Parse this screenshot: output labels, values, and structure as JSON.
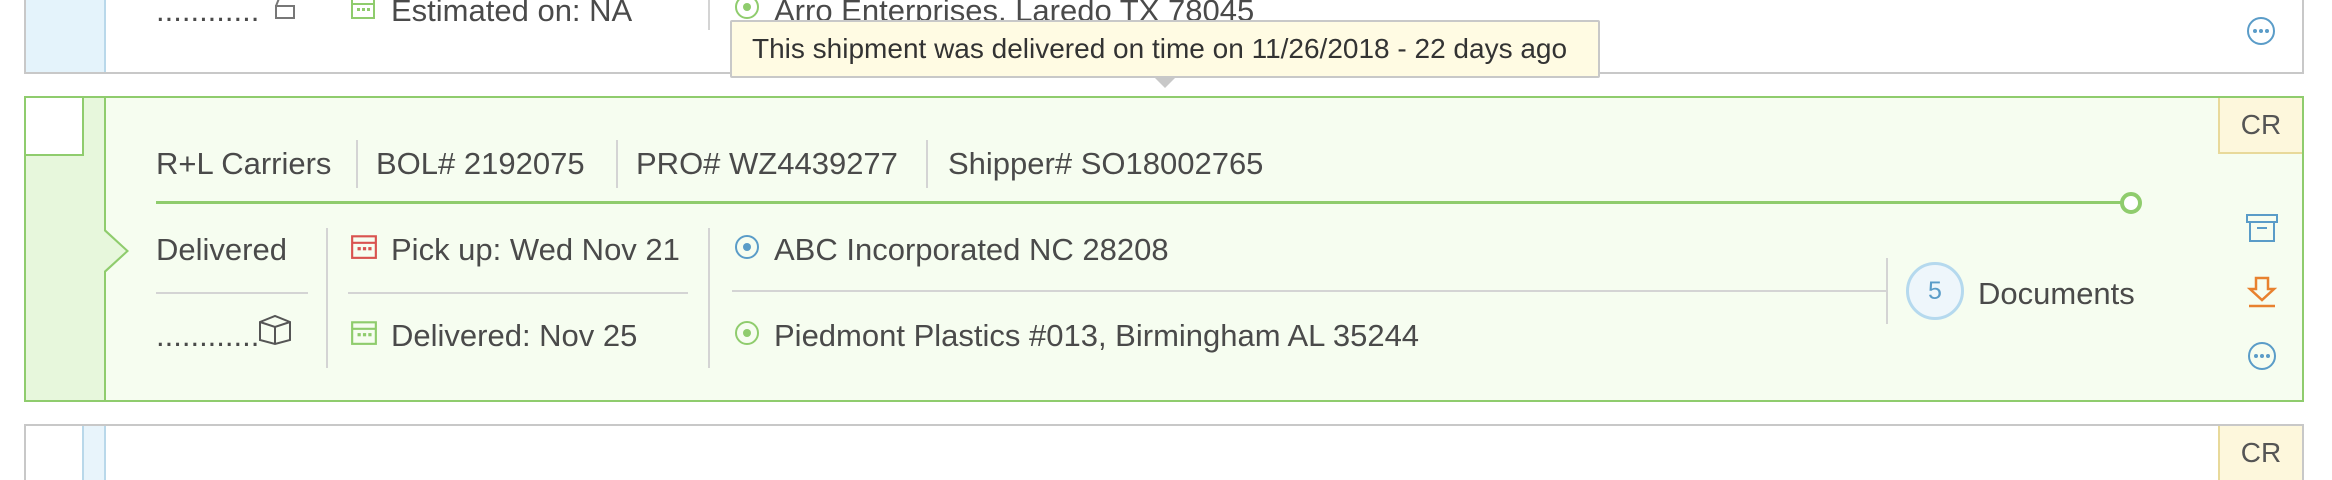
{
  "tooltip": {
    "text": "This shipment was delivered on time on 11/26/2018 - 22 days ago"
  },
  "top_card": {
    "dots": "............",
    "estimated": "Estimated on: NA",
    "destination": "Arro Enterprises, Laredo  TX 78045"
  },
  "main_card": {
    "carrier": "R+L Carriers",
    "bol": "BOL# 2192075",
    "pro": "PRO# WZ4439277",
    "shipper": "Shipper# SO18002765",
    "status": "Delivered",
    "dots": "............",
    "pickup": "Pick up: Wed Nov 21",
    "delivered": "Delivered: Nov 25",
    "origin": "ABC Incorporated  NC 28208",
    "destination": "Piedmont Plastics #013, Birmingham  AL 35244",
    "documents_count": "5",
    "documents_label": "Documents",
    "badge": "CR",
    "progress": 1.0
  },
  "bottom_card": {
    "badge": "CR"
  },
  "colors": {
    "delivered_green": "#8fcc6d",
    "link_blue": "#5a9cc8",
    "download_orange": "#e8812f",
    "pickup_red": "#d9534f"
  },
  "icons": [
    "clapper-icon",
    "calendar-icon",
    "target-icon",
    "more-icon",
    "archive-icon",
    "download-icon",
    "box-icon"
  ]
}
